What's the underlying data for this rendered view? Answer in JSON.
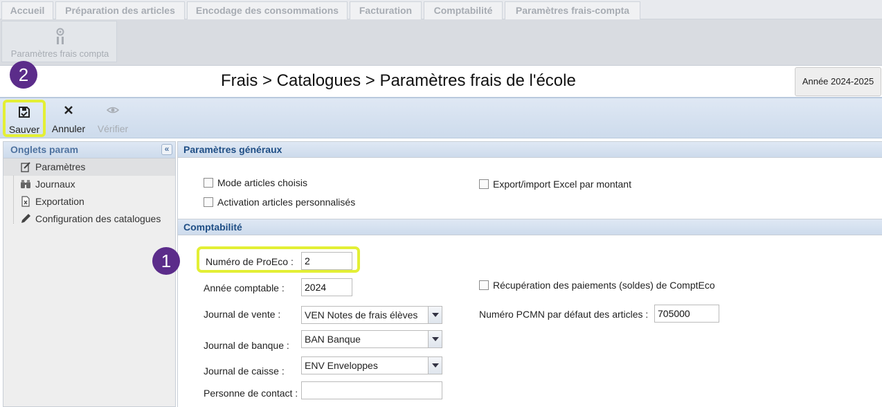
{
  "top_tabs": [
    "Accueil",
    "Préparation des articles",
    "Encodage des consommations",
    "Facturation",
    "Comptabilité",
    "Paramètres frais-compta"
  ],
  "ribbon": {
    "button_label": "Paramètres frais compta",
    "icon": "medal-icon"
  },
  "header": {
    "breadcrumb": "Frais > Catalogues > Paramètres frais de l'école",
    "year_button": "Année 2024-2025"
  },
  "badges": {
    "step1": "1",
    "step2": "2"
  },
  "toolbar": {
    "save_label": "Sauver",
    "cancel_label": "Annuler",
    "verify_label": "Vérifier"
  },
  "sidebar": {
    "title": "Onglets param",
    "items": [
      {
        "label": "Paramètres",
        "icon": "edit-note-icon",
        "selected": true
      },
      {
        "label": "Journaux",
        "icon": "binoculars-icon"
      },
      {
        "label": "Exportation",
        "icon": "excel-file-icon"
      },
      {
        "label": "Configuration des catalogues",
        "icon": "pencil-icon"
      }
    ]
  },
  "general": {
    "title": "Paramètres généraux",
    "mode_articles_label": "Mode articles choisis",
    "activation_label": "Activation articles personnalisés",
    "export_excel_label": "Export/import Excel par montant"
  },
  "compta": {
    "title": "Comptabilité",
    "proeco_label": "Numéro de ProEco :",
    "proeco_value": "2",
    "annee_label": "Année comptable :",
    "annee_value": "2024",
    "vente_label": "Journal de vente :",
    "vente_value": "VEN Notes de frais élèves",
    "banque_label": "Journal de banque :",
    "banque_value": "BAN Banque",
    "caisse_label": "Journal de caisse :",
    "caisse_value": "ENV Enveloppes",
    "contact_label": "Personne de contact :",
    "contact_value": "",
    "recup_label": "Récupération des paiements (soldes) de ComptEco",
    "pcmn_label": "Numéro PCMN par défaut des articles :",
    "pcmn_value": "705000"
  },
  "colors": {
    "highlight": "#e3ef35",
    "badge": "#5b2c8a",
    "section_title": "#1f4e85"
  }
}
